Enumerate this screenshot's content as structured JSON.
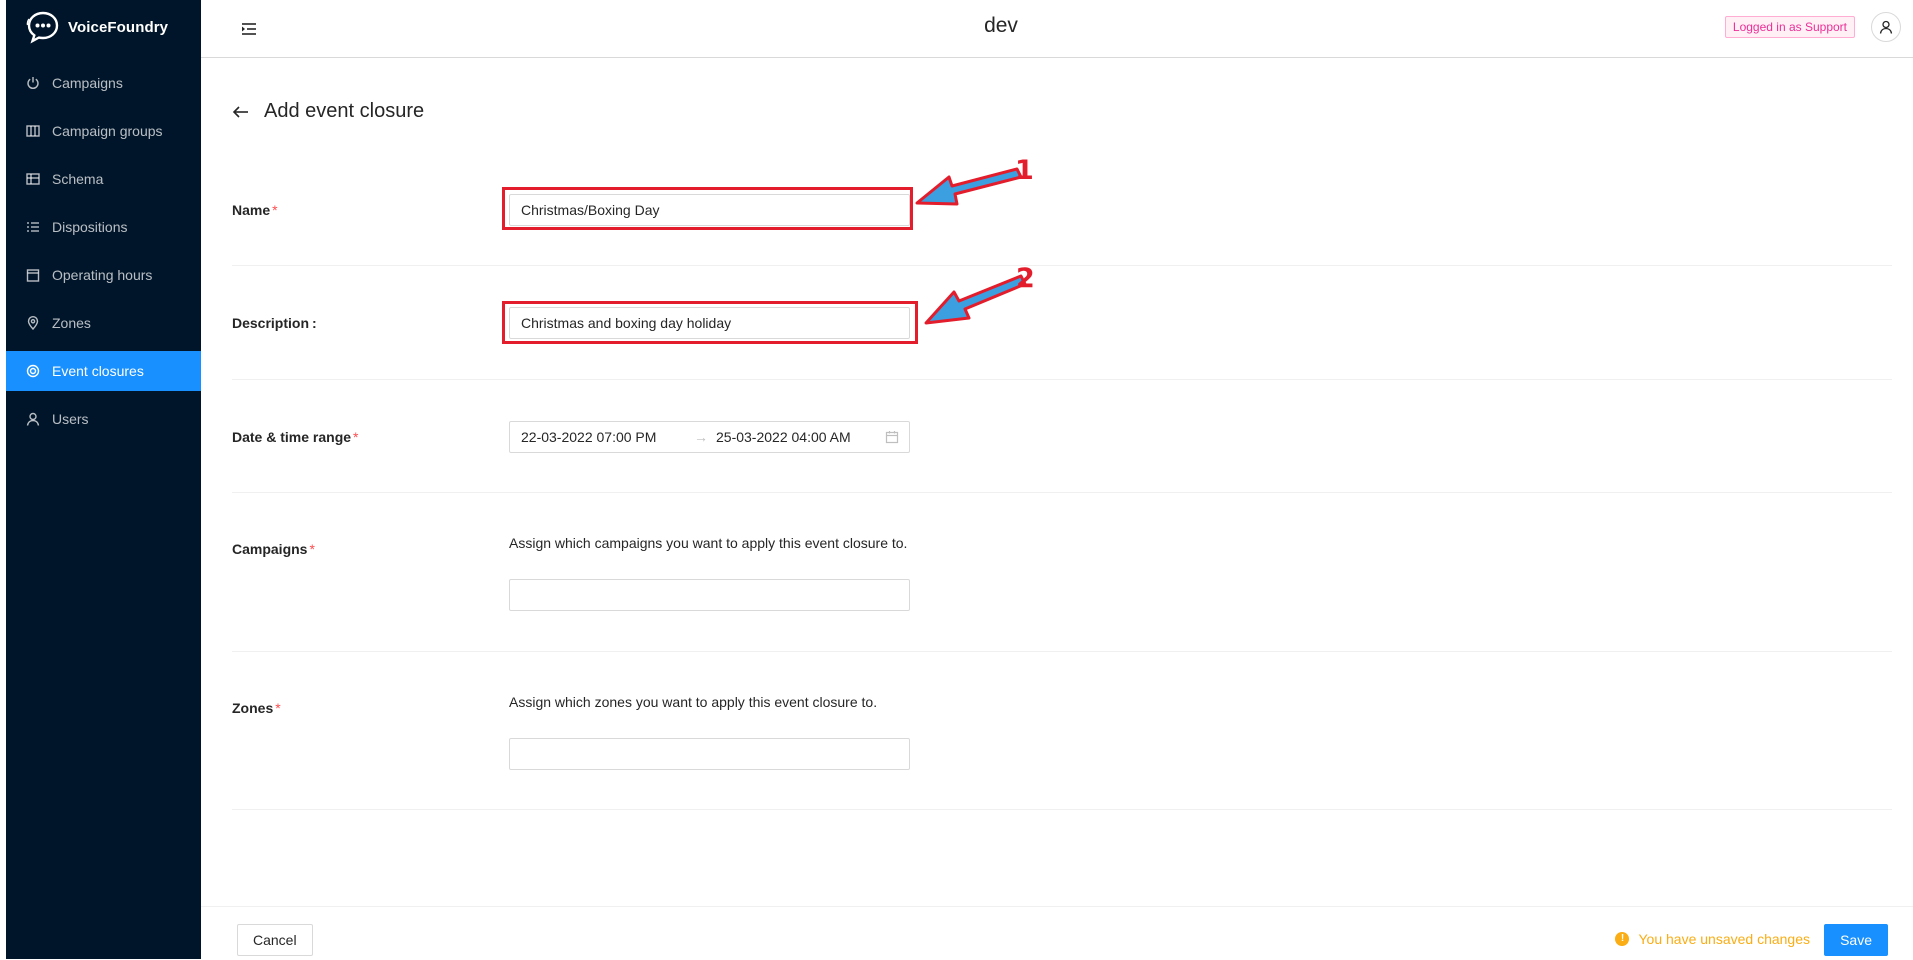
{
  "app": {
    "brand_name": "VoiceFoundry",
    "environment": "dev",
    "user_tag": "Logged in as Support"
  },
  "sidebar": {
    "items": [
      {
        "label": "Campaigns",
        "icon": "power-icon",
        "active": false
      },
      {
        "label": "Campaign groups",
        "icon": "group-icon",
        "active": false
      },
      {
        "label": "Schema",
        "icon": "table-icon",
        "active": false
      },
      {
        "label": "Dispositions",
        "icon": "list-icon",
        "active": false
      },
      {
        "label": "Operating hours",
        "icon": "calendar-icon",
        "active": false
      },
      {
        "label": "Zones",
        "icon": "location-pin-icon",
        "active": false
      },
      {
        "label": "Event closures",
        "icon": "target-icon",
        "active": true
      },
      {
        "label": "Users",
        "icon": "user-icon",
        "active": false
      }
    ]
  },
  "page": {
    "title": "Add event closure"
  },
  "form": {
    "name": {
      "label": "Name",
      "required_mark": "*",
      "value": "Christmas/Boxing Day"
    },
    "description": {
      "label": "Description",
      "colon": ":",
      "value": "Christmas and boxing day holiday"
    },
    "date_range": {
      "label": "Date & time range",
      "required_mark": "*",
      "start": "22-03-2022 07:00 PM",
      "separator": "→",
      "end": "25-03-2022 04:00 AM"
    },
    "campaigns": {
      "label": "Campaigns",
      "required_mark": "*",
      "help": "Assign which campaigns you want to apply this event closure to.",
      "value": ""
    },
    "zones": {
      "label": "Zones",
      "required_mark": "*",
      "help": "Assign which zones you want to apply this event closure to.",
      "value": ""
    }
  },
  "annotations": {
    "marker_1": "1",
    "marker_2": "2",
    "color": "#e31d2b",
    "arrow_fill": "#3b9fe0"
  },
  "footer": {
    "cancel_label": "Cancel",
    "unsaved_text": "You have unsaved changes",
    "unsaved_icon": "!",
    "save_label": "Save"
  },
  "colors": {
    "sidebar_bg": "#001529",
    "accent": "#1890ff",
    "required": "#ff4d4f",
    "warning": "#faad14",
    "tag_pink": "#eb2f96"
  }
}
